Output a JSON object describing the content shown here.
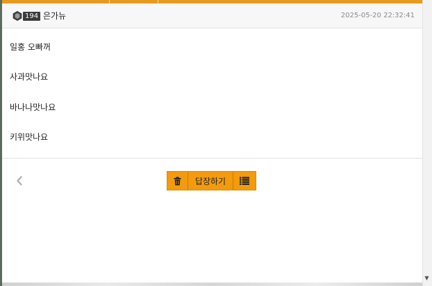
{
  "post": {
    "author": {
      "level": "194",
      "name": "은가뉴"
    },
    "date": "2025-05-20 22:32:41",
    "content_lines": [
      "일홍 오빠꺼",
      "사과맛나요",
      "바나나맛나요",
      "키위맛나요"
    ]
  },
  "actions": {
    "reply_label": "답장하기"
  },
  "icons": {
    "level_badge": "level-badge-icon",
    "prev": "chevron-left-icon",
    "delete": "trash-icon",
    "list": "list-icon",
    "scroll_down": "caret-down-icon"
  },
  "colors": {
    "accent": "#e89a1f",
    "button_fill": "#f39b0d",
    "text": "#222222",
    "date": "#8a8a8a",
    "header_bg": "#f7f7f7"
  }
}
